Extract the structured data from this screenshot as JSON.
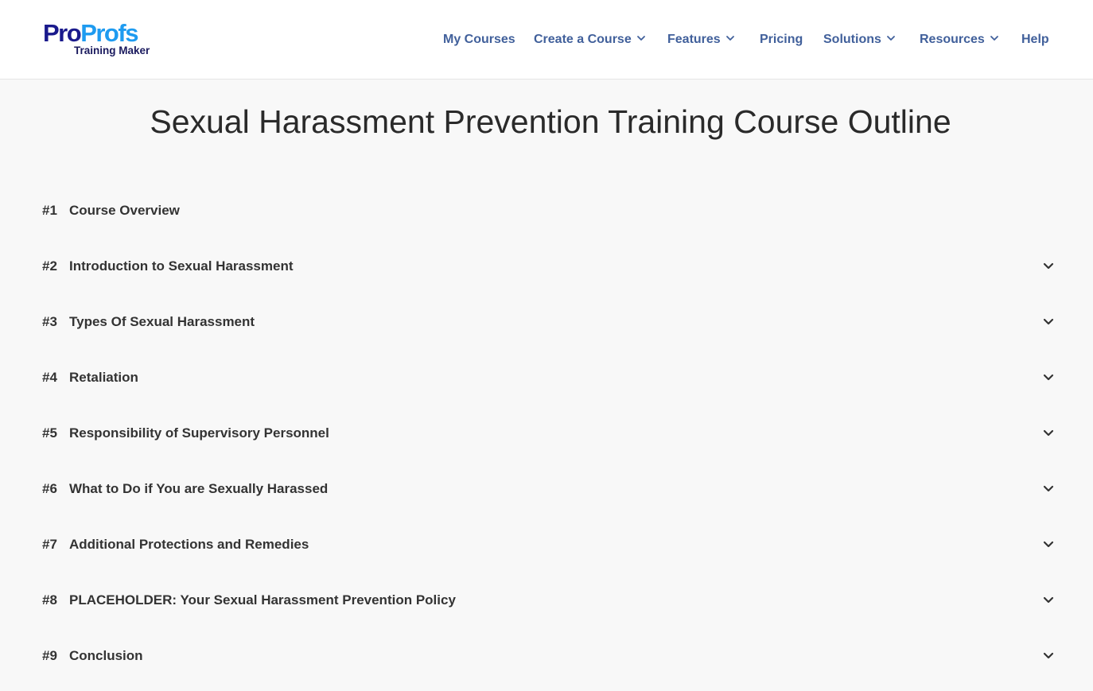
{
  "header": {
    "logo": {
      "pro": "Pro",
      "profs": "Profs",
      "subtitle": "Training Maker"
    },
    "nav": [
      {
        "label": "My Courses",
        "has_dropdown": false
      },
      {
        "label": "Create a Course",
        "has_dropdown": true
      },
      {
        "label": "Features",
        "has_dropdown": true
      },
      {
        "label": "Pricing",
        "has_dropdown": false
      },
      {
        "label": "Solutions",
        "has_dropdown": true
      },
      {
        "label": "Resources",
        "has_dropdown": true
      },
      {
        "label": "Help",
        "has_dropdown": false
      }
    ]
  },
  "page": {
    "title": "Sexual Harassment Prevention Training Course Outline"
  },
  "outline": [
    {
      "number": "#1",
      "label": "Course Overview",
      "expandable": false,
      "icon": "chevron-down-icon"
    },
    {
      "number": "#2",
      "label": "Introduction to Sexual Harassment",
      "expandable": true,
      "icon": "chevron-down-icon"
    },
    {
      "number": "#3",
      "label": "Types Of Sexual Harassment",
      "expandable": true,
      "icon": "chevron-down-icon"
    },
    {
      "number": "#4",
      "label": "Retaliation",
      "expandable": true,
      "icon": "chevron-down-icon"
    },
    {
      "number": "#5",
      "label": "Responsibility of Supervisory Personnel",
      "expandable": true,
      "icon": "chevron-down-icon"
    },
    {
      "number": "#6",
      "label": "What to Do if You are Sexually Harassed",
      "expandable": true,
      "icon": "chevron-down-icon"
    },
    {
      "number": "#7",
      "label": "Additional Protections and Remedies",
      "expandable": true,
      "icon": "chevron-down-icon"
    },
    {
      "number": "#8",
      "label": "PLACEHOLDER: Your Sexual Harassment Prevention Policy",
      "expandable": true,
      "icon": "chevron-down-icon"
    },
    {
      "number": "#9",
      "label": "Conclusion",
      "expandable": true,
      "icon": "chevron-down-icon"
    }
  ],
  "colors": {
    "logo_pro": "#1a1a8c",
    "logo_profs": "#1e9bf0",
    "nav_text": "#41609b",
    "title_text": "#2a2a2a",
    "row_text": "#333333",
    "page_background": "#f8f8f8",
    "header_background": "#ffffff"
  }
}
